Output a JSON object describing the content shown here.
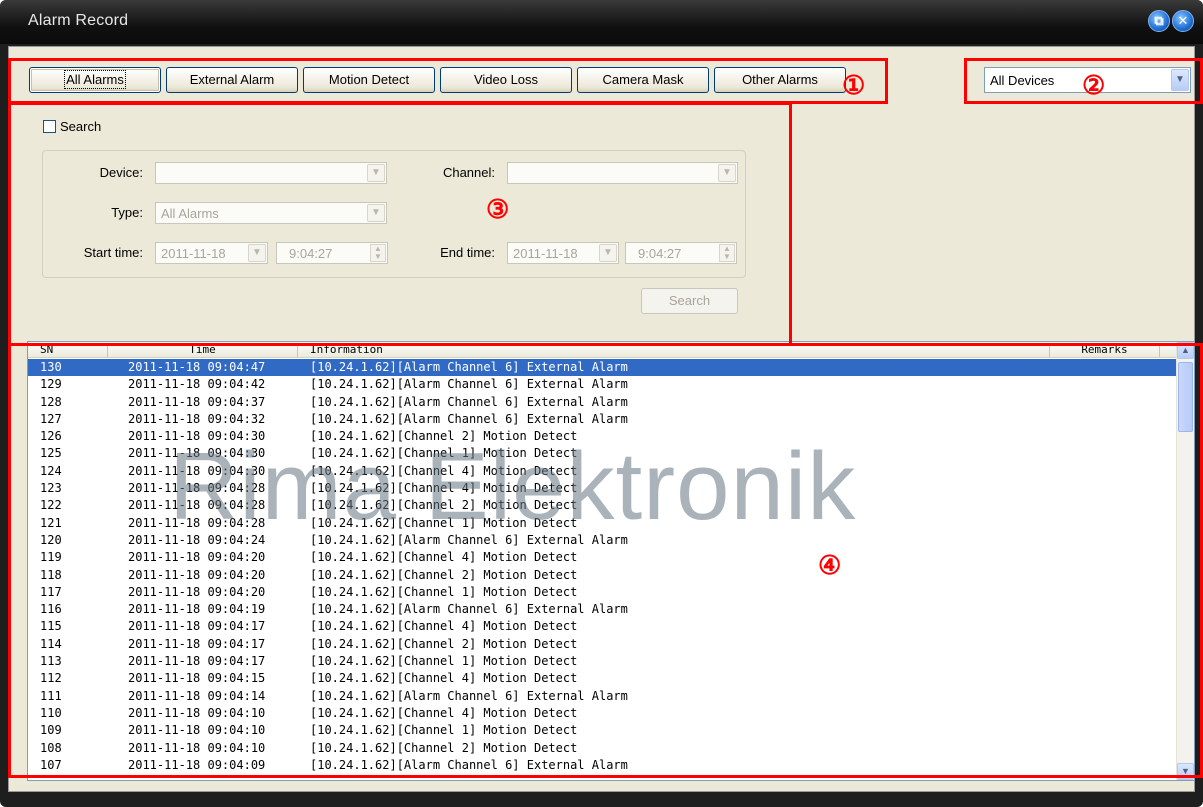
{
  "window": {
    "title": "Alarm Record"
  },
  "tabs": [
    {
      "label": "All Alarms",
      "active": true
    },
    {
      "label": "External Alarm",
      "active": false
    },
    {
      "label": "Motion Detect",
      "active": false
    },
    {
      "label": "Video Loss",
      "active": false
    },
    {
      "label": "Camera Mask",
      "active": false
    },
    {
      "label": "Other Alarms",
      "active": false
    }
  ],
  "device_filter": {
    "selected": "All Devices"
  },
  "search": {
    "checkbox_label": "Search",
    "checked": false,
    "device_label": "Device:",
    "device_value": "",
    "channel_label": "Channel:",
    "channel_value": "",
    "type_label": "Type:",
    "type_value": "All Alarms",
    "start_label": "Start time:",
    "start_date": "2011-11-18",
    "start_time": "9:04:27",
    "end_label": "End time:",
    "end_date": "2011-11-18",
    "end_time": "9:04:27",
    "button": "Search"
  },
  "table": {
    "columns": [
      "SN",
      "Time",
      "Information",
      "Remarks"
    ],
    "rows": [
      {
        "sn": "130",
        "time": "2011-11-18 09:04:47",
        "info": "[10.24.1.62][Alarm Channel 6] External Alarm",
        "remarks": "",
        "selected": true
      },
      {
        "sn": "129",
        "time": "2011-11-18 09:04:42",
        "info": "[10.24.1.62][Alarm Channel 6] External Alarm",
        "remarks": ""
      },
      {
        "sn": "128",
        "time": "2011-11-18 09:04:37",
        "info": "[10.24.1.62][Alarm Channel 6] External Alarm",
        "remarks": ""
      },
      {
        "sn": "127",
        "time": "2011-11-18 09:04:32",
        "info": "[10.24.1.62][Alarm Channel 6] External Alarm",
        "remarks": ""
      },
      {
        "sn": "126",
        "time": "2011-11-18 09:04:30",
        "info": "[10.24.1.62][Channel 2] Motion Detect",
        "remarks": ""
      },
      {
        "sn": "125",
        "time": "2011-11-18 09:04:30",
        "info": "[10.24.1.62][Channel 1] Motion Detect",
        "remarks": ""
      },
      {
        "sn": "124",
        "time": "2011-11-18 09:04:30",
        "info": "[10.24.1.62][Channel 4] Motion Detect",
        "remarks": ""
      },
      {
        "sn": "123",
        "time": "2011-11-18 09:04:28",
        "info": "[10.24.1.62][Channel 4] Motion Detect",
        "remarks": ""
      },
      {
        "sn": "122",
        "time": "2011-11-18 09:04:28",
        "info": "[10.24.1.62][Channel 2] Motion Detect",
        "remarks": ""
      },
      {
        "sn": "121",
        "time": "2011-11-18 09:04:28",
        "info": "[10.24.1.62][Channel 1] Motion Detect",
        "remarks": ""
      },
      {
        "sn": "120",
        "time": "2011-11-18 09:04:24",
        "info": "[10.24.1.62][Alarm Channel 6] External Alarm",
        "remarks": ""
      },
      {
        "sn": "119",
        "time": "2011-11-18 09:04:20",
        "info": "[10.24.1.62][Channel 4] Motion Detect",
        "remarks": ""
      },
      {
        "sn": "118",
        "time": "2011-11-18 09:04:20",
        "info": "[10.24.1.62][Channel 2] Motion Detect",
        "remarks": ""
      },
      {
        "sn": "117",
        "time": "2011-11-18 09:04:20",
        "info": "[10.24.1.62][Channel 1] Motion Detect",
        "remarks": ""
      },
      {
        "sn": "116",
        "time": "2011-11-18 09:04:19",
        "info": "[10.24.1.62][Alarm Channel 6] External Alarm",
        "remarks": ""
      },
      {
        "sn": "115",
        "time": "2011-11-18 09:04:17",
        "info": "[10.24.1.62][Channel 4] Motion Detect",
        "remarks": ""
      },
      {
        "sn": "114",
        "time": "2011-11-18 09:04:17",
        "info": "[10.24.1.62][Channel 2] Motion Detect",
        "remarks": ""
      },
      {
        "sn": "113",
        "time": "2011-11-18 09:04:17",
        "info": "[10.24.1.62][Channel 1] Motion Detect",
        "remarks": ""
      },
      {
        "sn": "112",
        "time": "2011-11-18 09:04:15",
        "info": "[10.24.1.62][Channel 4] Motion Detect",
        "remarks": ""
      },
      {
        "sn": "111",
        "time": "2011-11-18 09:04:14",
        "info": "[10.24.1.62][Alarm Channel 6] External Alarm",
        "remarks": ""
      },
      {
        "sn": "110",
        "time": "2011-11-18 09:04:10",
        "info": "[10.24.1.62][Channel 4] Motion Detect",
        "remarks": ""
      },
      {
        "sn": "109",
        "time": "2011-11-18 09:04:10",
        "info": "[10.24.1.62][Channel 1] Motion Detect",
        "remarks": ""
      },
      {
        "sn": "108",
        "time": "2011-11-18 09:04:10",
        "info": "[10.24.1.62][Channel 2] Motion Detect",
        "remarks": ""
      },
      {
        "sn": "107",
        "time": "2011-11-18 09:04:09",
        "info": "[10.24.1.62][Alarm Channel 6] External Alarm",
        "remarks": ""
      }
    ]
  },
  "watermark": "Rima Elektronik",
  "annotations": [
    "①",
    "②",
    "③",
    "④"
  ],
  "colors": {
    "selection": "#316ac5",
    "annotation": "#ff0000",
    "panel": "#ece9d8"
  }
}
